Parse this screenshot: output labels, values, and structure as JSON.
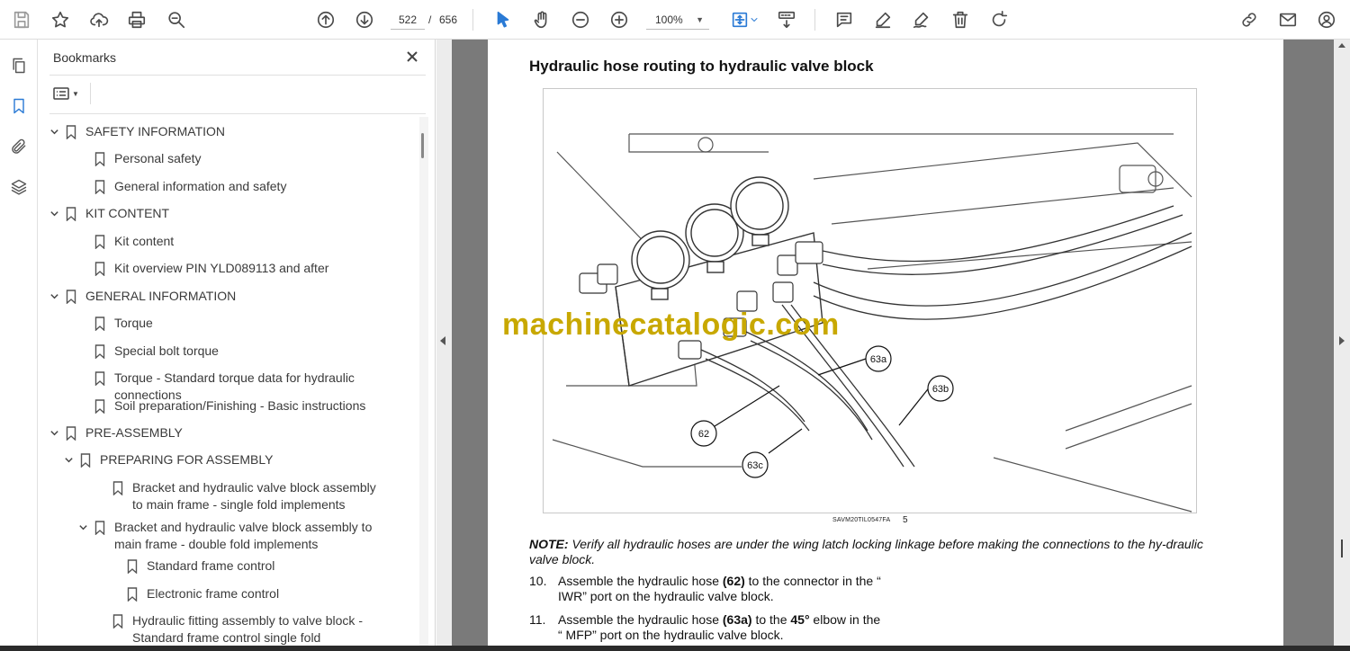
{
  "toolbar": {
    "current_page": "522",
    "page_separator": "/",
    "total_pages": "656",
    "zoom": "100%"
  },
  "bookmarks_panel": {
    "title": "Bookmarks",
    "items": [
      {
        "label": "SAFETY INFORMATION",
        "chevron": "down"
      },
      {
        "label": "Personal safety"
      },
      {
        "label": "General information and safety"
      },
      {
        "label": "KIT CONTENT",
        "chevron": "down"
      },
      {
        "label": "Kit content"
      },
      {
        "label": "Kit overview PIN YLD089113 and after"
      },
      {
        "label": "GENERAL INFORMATION",
        "chevron": "down"
      },
      {
        "label": "Torque"
      },
      {
        "label": "Special bolt torque"
      },
      {
        "label": "Torque - Standard torque data for hydraulic connections"
      },
      {
        "label": "Soil preparation/Finishing - Basic instructions"
      },
      {
        "label": "PRE-ASSEMBLY",
        "chevron": "down"
      },
      {
        "label": "PREPARING FOR ASSEMBLY",
        "chevron": "down"
      },
      {
        "label": "Bracket and hydraulic valve block assembly to main frame - single fold implements"
      },
      {
        "label": "Bracket and hydraulic valve block assembly to main frame - double fold implements",
        "chevron": "down"
      },
      {
        "label": "Standard frame control"
      },
      {
        "label": "Electronic frame control"
      },
      {
        "label": "Hydraulic fitting assembly to valve block - Standard frame control single fold implements"
      }
    ]
  },
  "document": {
    "heading": "Hydraulic hose routing to hydraulic valve block",
    "figure_caption": "SAVM20TIL0547FA",
    "figure_number": "5",
    "watermark": "machinecatalogic.com",
    "callouts": [
      "63a",
      "63b",
      "62",
      "63c"
    ],
    "note_label": "NOTE:",
    "note_text": "Verify all hydraulic hoses are under the wing latch locking linkage before making the connections to the hy-draulic valve block.",
    "steps": [
      {
        "num": "10.",
        "pre": "Assemble the hydraulic hose ",
        "bold": "(62)",
        "post": " to the connector in the “ IWR” port on the hydraulic valve block."
      },
      {
        "num": "11.",
        "pre": "Assemble the hydraulic hose ",
        "bold": "(63a)",
        "post": " to the ",
        "bold2": "45°",
        "post2": " elbow in the “ MFP” port on the hydraulic valve block."
      }
    ]
  }
}
